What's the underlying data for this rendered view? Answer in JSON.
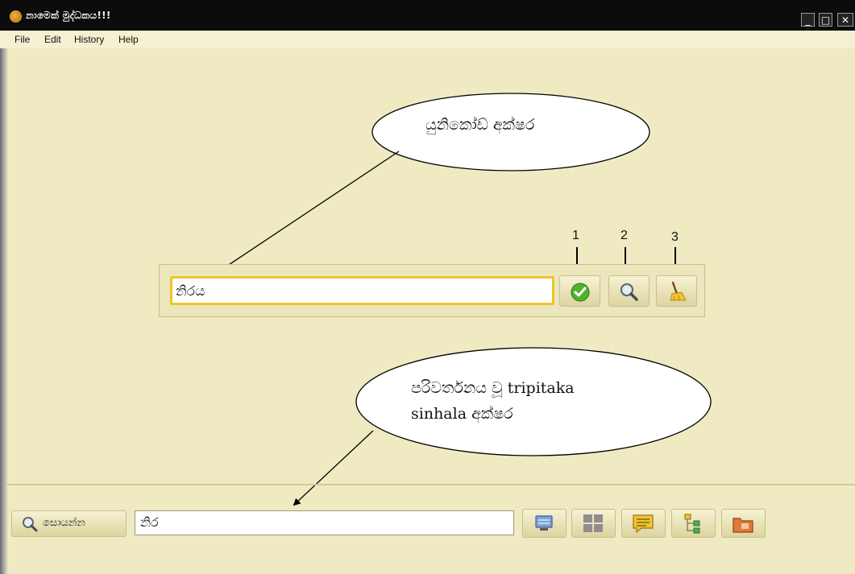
{
  "window": {
    "title": "නාමෙක් මුද්ධකය!!!",
    "minimize_glyph": "_",
    "maximize_glyph": "□",
    "close_glyph": "✕"
  },
  "menu": [
    "File",
    "Edit",
    "History",
    "Help"
  ],
  "callouts": {
    "top": "යුනිකෝඩ් අක්ෂර",
    "bottom_line1": "පරිවර්තනය වූ tripitaka",
    "bottom_line2": "sinhala අක්ෂර"
  },
  "input": {
    "value": "නිරය"
  },
  "step_labels": [
    "1",
    "2",
    "3"
  ],
  "toolbar": {
    "convert_icon": "check-icon",
    "search_icon": "magnifier-icon",
    "clear_icon": "broom-icon"
  },
  "bottom": {
    "search_label": "සොයන්න",
    "output_value": "නිර",
    "icons": [
      "monitor-icon",
      "grid-icon",
      "comment-icon",
      "tree-icon",
      "folder-icon"
    ]
  },
  "colors": {
    "background": "#efeac2",
    "input_focus_border": "#f0c52a",
    "titlebar": "#0c0c0c"
  }
}
